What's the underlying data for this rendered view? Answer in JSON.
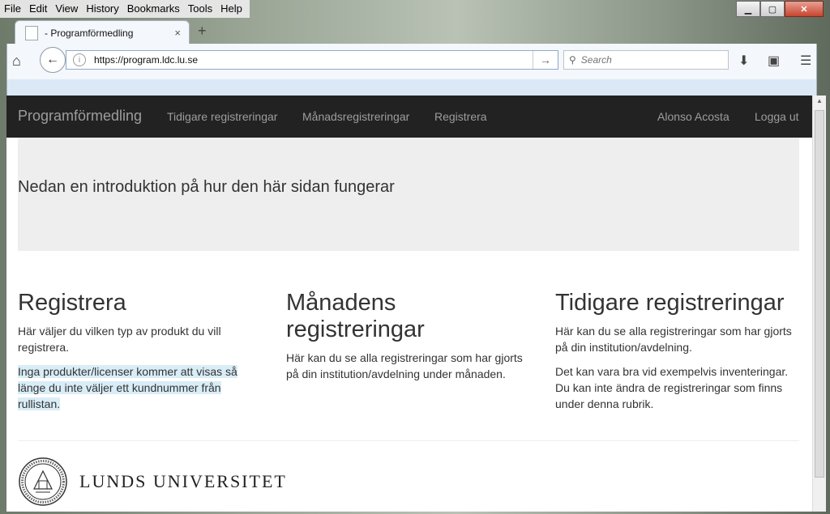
{
  "menubar": {
    "items": [
      "File",
      "Edit",
      "View",
      "History",
      "Bookmarks",
      "Tools",
      "Help"
    ]
  },
  "tab": {
    "title": "- Programförmedling",
    "close": "×"
  },
  "newtab": "+",
  "urlbar": {
    "value": "https://program.ldc.lu.se"
  },
  "search": {
    "placeholder": "Search"
  },
  "site": {
    "brand": "Programförmedling",
    "nav": [
      "Tidigare registreringar",
      "Månadsregistreringar",
      "Registrera"
    ],
    "user": "Alonso Acosta",
    "logout": "Logga ut"
  },
  "jumbotron": {
    "text": "Nedan en introduktion på hur den här sidan fungerar"
  },
  "columns": [
    {
      "title": "Registrera",
      "p1": "Här väljer du vilken typ av produkt du vill registrera.",
      "p2": "Inga produkter/licenser kommer att visas så länge du inte väljer ett kundnummer från rullistan."
    },
    {
      "title": "Månadens registreringar",
      "p1": "Här kan du se alla registreringar som har gjorts på din institution/avdelning under månaden."
    },
    {
      "title": "Tidigare registreringar",
      "p1": "Här kan du se alla registreringar som har gjorts på din institution/avdelning.",
      "p2": "Det kan vara bra vid exempelvis inventeringar. Du kan inte ändra de registreringar som finns under denna rubrik."
    }
  ],
  "footer": {
    "university": "LUNDS UNIVERSITET"
  },
  "icons": {
    "home": "home-icon",
    "back": "back-arrow-icon",
    "download": "download-icon",
    "sidebar": "sidebar-icon",
    "menu": "hamburger-menu-icon"
  }
}
